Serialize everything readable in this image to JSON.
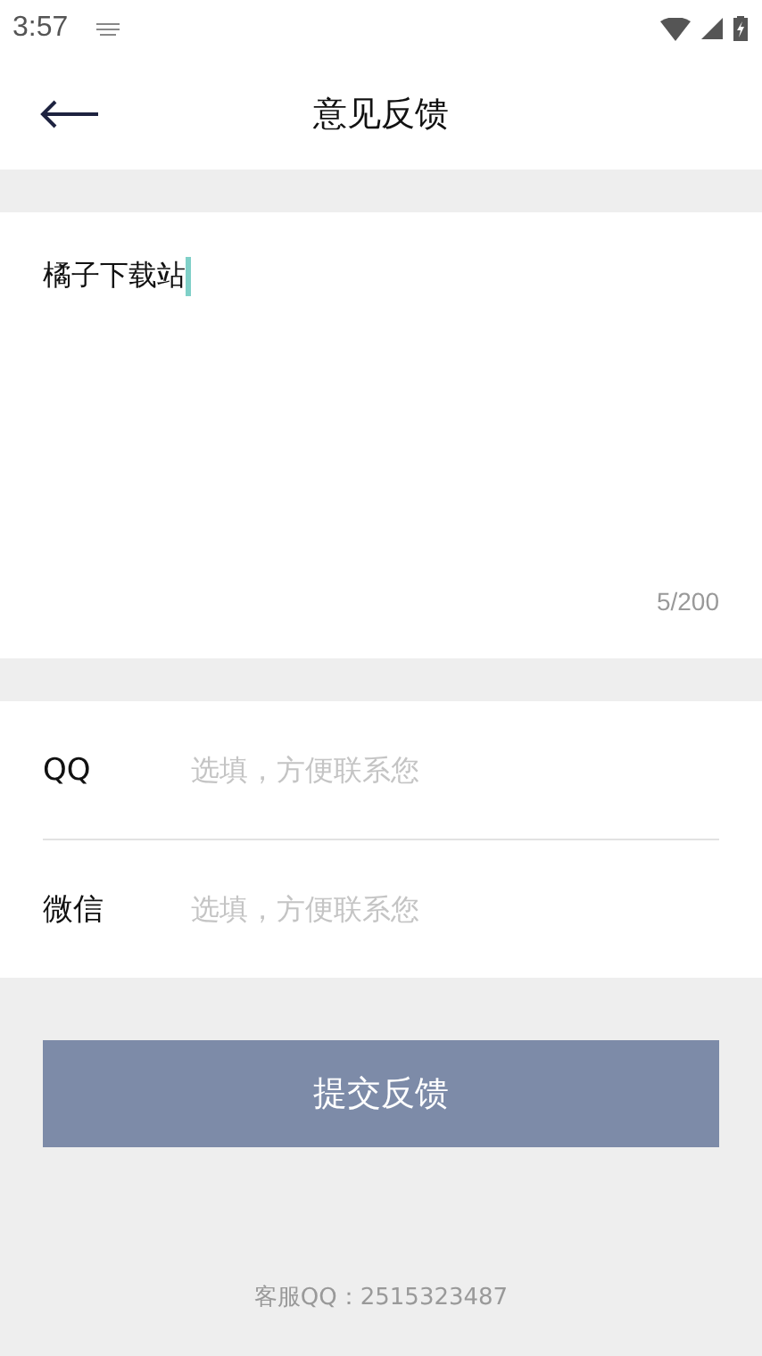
{
  "status_bar": {
    "time": "3:57"
  },
  "header": {
    "title": "意见反馈"
  },
  "feedback": {
    "value": "橘子下载站",
    "counter": "5/200"
  },
  "contacts": [
    {
      "label": "QQ",
      "placeholder": "选填，方便联系您"
    },
    {
      "label": "微信",
      "placeholder": "选填，方便联系您"
    }
  ],
  "submit": "提交反馈",
  "footer": "客服QQ：2515323487"
}
